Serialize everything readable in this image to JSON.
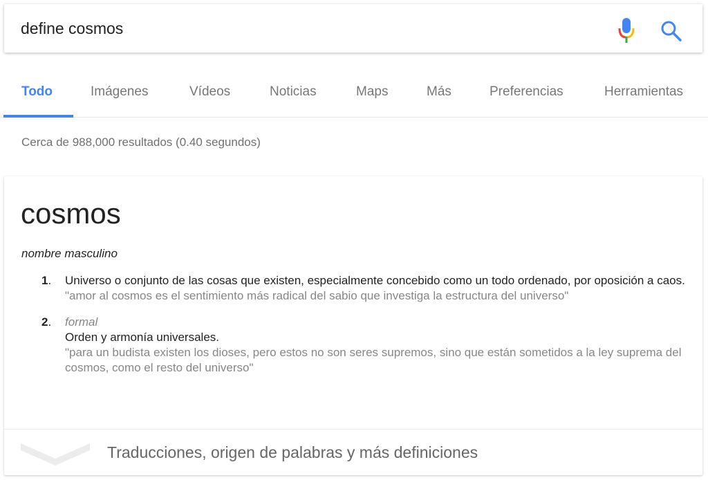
{
  "search": {
    "query": "define cosmos",
    "mic_icon": "mic-icon",
    "search_icon": "search-icon"
  },
  "tabs": [
    {
      "label": "Todo",
      "active": true
    },
    {
      "label": "Imágenes",
      "active": false
    },
    {
      "label": "Vídeos",
      "active": false
    },
    {
      "label": "Noticias",
      "active": false
    },
    {
      "label": "Maps",
      "active": false
    },
    {
      "label": "Más",
      "active": false
    },
    {
      "label": "Preferencias",
      "active": false
    },
    {
      "label": "Herramientas",
      "active": false
    }
  ],
  "result_stats": "Cerca de 988,000 resultados (0.40 segundos)",
  "dictionary": {
    "word": "cosmos",
    "part_of_speech": "nombre masculino",
    "definitions": [
      {
        "number": "1",
        "label": "",
        "text": "Universo o conjunto de las cosas que existen, especialmente concebido como un todo ordenado, por oposición a caos.",
        "example": "\"amor al cosmos es el sentimiento más radical del sabio que investiga la estructura del universo\""
      },
      {
        "number": "2",
        "label": "formal",
        "text": "Orden y armonía universales.",
        "example": "\"para un budista existen los dioses, pero estos no son seres supremos, sino que están sometidos a la ley suprema del cosmos, como el resto del universo\""
      }
    ],
    "more_label": "Traducciones, origen de palabras y más definiciones"
  },
  "colors": {
    "accent": "#4285f4",
    "mic_blue": "#4285f4",
    "mic_red": "#ea4335",
    "mic_yellow": "#fbbc05",
    "mic_green": "#34a853",
    "muted_text": "#878787"
  }
}
